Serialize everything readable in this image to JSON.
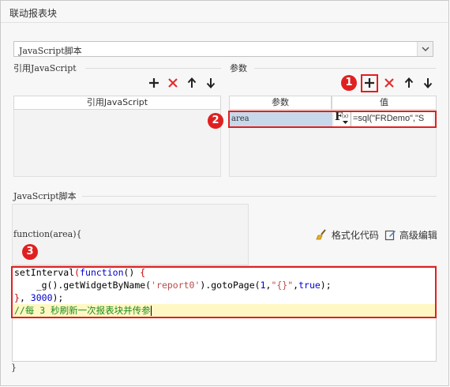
{
  "window": {
    "title": "联动报表块"
  },
  "type_select": {
    "value": "JavaScript脚本"
  },
  "ref_js": {
    "section_label": "引用JavaScript",
    "column_header": "引用JavaScript"
  },
  "params": {
    "section_label": "参数",
    "columns": [
      "参数",
      "值"
    ],
    "rows": [
      {
        "name": "area",
        "value": "=sql(\"FRDemo\",\"S"
      }
    ]
  },
  "toolbar_icons": [
    "add-icon",
    "delete-icon",
    "move-up-icon",
    "move-down-icon"
  ],
  "script": {
    "section_label": "JavaScript脚本",
    "signature": "function(area){",
    "format_label": "格式化代码",
    "advanced_label": "高级编辑",
    "closing": "}",
    "code": {
      "l1_name": "setInterval",
      "l1_paren": "(",
      "l1_kw": "function",
      "l1_rest": "() ",
      "l1_brace": "{",
      "l2_a": "    _g().getWidgetByName(",
      "l2_str": "'report0'",
      "l2_b": ").gotoPage(",
      "l2_num": "1",
      "l2_c": ",",
      "l2_str2": "\"{}\"",
      "l2_d": ",",
      "l2_kw": "true",
      "l2_e": ");",
      "l3_brace": "}",
      "l3_a": ", ",
      "l3_num": "3000",
      "l3_b": ");",
      "l4_comment": "//每 3 秒刷新一次报表块并传参"
    }
  },
  "annotations": {
    "badge1": "1",
    "badge2": "2",
    "badge3": "3"
  },
  "colors": {
    "annotation_red": "#e02020",
    "highlight_yellow": "#fff8c4",
    "param_selected": "#c7d8ea"
  }
}
